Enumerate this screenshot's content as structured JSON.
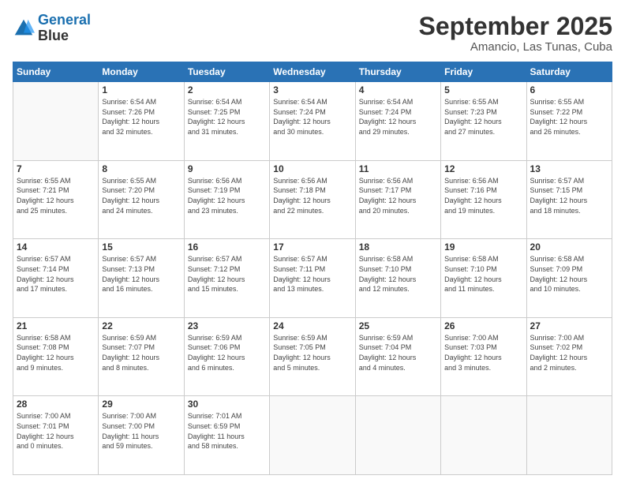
{
  "logo": {
    "line1": "General",
    "line2": "Blue"
  },
  "title": "September 2025",
  "location": "Amancio, Las Tunas, Cuba",
  "weekdays": [
    "Sunday",
    "Monday",
    "Tuesday",
    "Wednesday",
    "Thursday",
    "Friday",
    "Saturday"
  ],
  "weeks": [
    [
      {
        "day": "",
        "info": ""
      },
      {
        "day": "1",
        "info": "Sunrise: 6:54 AM\nSunset: 7:26 PM\nDaylight: 12 hours\nand 32 minutes."
      },
      {
        "day": "2",
        "info": "Sunrise: 6:54 AM\nSunset: 7:25 PM\nDaylight: 12 hours\nand 31 minutes."
      },
      {
        "day": "3",
        "info": "Sunrise: 6:54 AM\nSunset: 7:24 PM\nDaylight: 12 hours\nand 30 minutes."
      },
      {
        "day": "4",
        "info": "Sunrise: 6:54 AM\nSunset: 7:24 PM\nDaylight: 12 hours\nand 29 minutes."
      },
      {
        "day": "5",
        "info": "Sunrise: 6:55 AM\nSunset: 7:23 PM\nDaylight: 12 hours\nand 27 minutes."
      },
      {
        "day": "6",
        "info": "Sunrise: 6:55 AM\nSunset: 7:22 PM\nDaylight: 12 hours\nand 26 minutes."
      }
    ],
    [
      {
        "day": "7",
        "info": "Sunrise: 6:55 AM\nSunset: 7:21 PM\nDaylight: 12 hours\nand 25 minutes."
      },
      {
        "day": "8",
        "info": "Sunrise: 6:55 AM\nSunset: 7:20 PM\nDaylight: 12 hours\nand 24 minutes."
      },
      {
        "day": "9",
        "info": "Sunrise: 6:56 AM\nSunset: 7:19 PM\nDaylight: 12 hours\nand 23 minutes."
      },
      {
        "day": "10",
        "info": "Sunrise: 6:56 AM\nSunset: 7:18 PM\nDaylight: 12 hours\nand 22 minutes."
      },
      {
        "day": "11",
        "info": "Sunrise: 6:56 AM\nSunset: 7:17 PM\nDaylight: 12 hours\nand 20 minutes."
      },
      {
        "day": "12",
        "info": "Sunrise: 6:56 AM\nSunset: 7:16 PM\nDaylight: 12 hours\nand 19 minutes."
      },
      {
        "day": "13",
        "info": "Sunrise: 6:57 AM\nSunset: 7:15 PM\nDaylight: 12 hours\nand 18 minutes."
      }
    ],
    [
      {
        "day": "14",
        "info": "Sunrise: 6:57 AM\nSunset: 7:14 PM\nDaylight: 12 hours\nand 17 minutes."
      },
      {
        "day": "15",
        "info": "Sunrise: 6:57 AM\nSunset: 7:13 PM\nDaylight: 12 hours\nand 16 minutes."
      },
      {
        "day": "16",
        "info": "Sunrise: 6:57 AM\nSunset: 7:12 PM\nDaylight: 12 hours\nand 15 minutes."
      },
      {
        "day": "17",
        "info": "Sunrise: 6:57 AM\nSunset: 7:11 PM\nDaylight: 12 hours\nand 13 minutes."
      },
      {
        "day": "18",
        "info": "Sunrise: 6:58 AM\nSunset: 7:10 PM\nDaylight: 12 hours\nand 12 minutes."
      },
      {
        "day": "19",
        "info": "Sunrise: 6:58 AM\nSunset: 7:10 PM\nDaylight: 12 hours\nand 11 minutes."
      },
      {
        "day": "20",
        "info": "Sunrise: 6:58 AM\nSunset: 7:09 PM\nDaylight: 12 hours\nand 10 minutes."
      }
    ],
    [
      {
        "day": "21",
        "info": "Sunrise: 6:58 AM\nSunset: 7:08 PM\nDaylight: 12 hours\nand 9 minutes."
      },
      {
        "day": "22",
        "info": "Sunrise: 6:59 AM\nSunset: 7:07 PM\nDaylight: 12 hours\nand 8 minutes."
      },
      {
        "day": "23",
        "info": "Sunrise: 6:59 AM\nSunset: 7:06 PM\nDaylight: 12 hours\nand 6 minutes."
      },
      {
        "day": "24",
        "info": "Sunrise: 6:59 AM\nSunset: 7:05 PM\nDaylight: 12 hours\nand 5 minutes."
      },
      {
        "day": "25",
        "info": "Sunrise: 6:59 AM\nSunset: 7:04 PM\nDaylight: 12 hours\nand 4 minutes."
      },
      {
        "day": "26",
        "info": "Sunrise: 7:00 AM\nSunset: 7:03 PM\nDaylight: 12 hours\nand 3 minutes."
      },
      {
        "day": "27",
        "info": "Sunrise: 7:00 AM\nSunset: 7:02 PM\nDaylight: 12 hours\nand 2 minutes."
      }
    ],
    [
      {
        "day": "28",
        "info": "Sunrise: 7:00 AM\nSunset: 7:01 PM\nDaylight: 12 hours\nand 0 minutes."
      },
      {
        "day": "29",
        "info": "Sunrise: 7:00 AM\nSunset: 7:00 PM\nDaylight: 11 hours\nand 59 minutes."
      },
      {
        "day": "30",
        "info": "Sunrise: 7:01 AM\nSunset: 6:59 PM\nDaylight: 11 hours\nand 58 minutes."
      },
      {
        "day": "",
        "info": ""
      },
      {
        "day": "",
        "info": ""
      },
      {
        "day": "",
        "info": ""
      },
      {
        "day": "",
        "info": ""
      }
    ]
  ]
}
